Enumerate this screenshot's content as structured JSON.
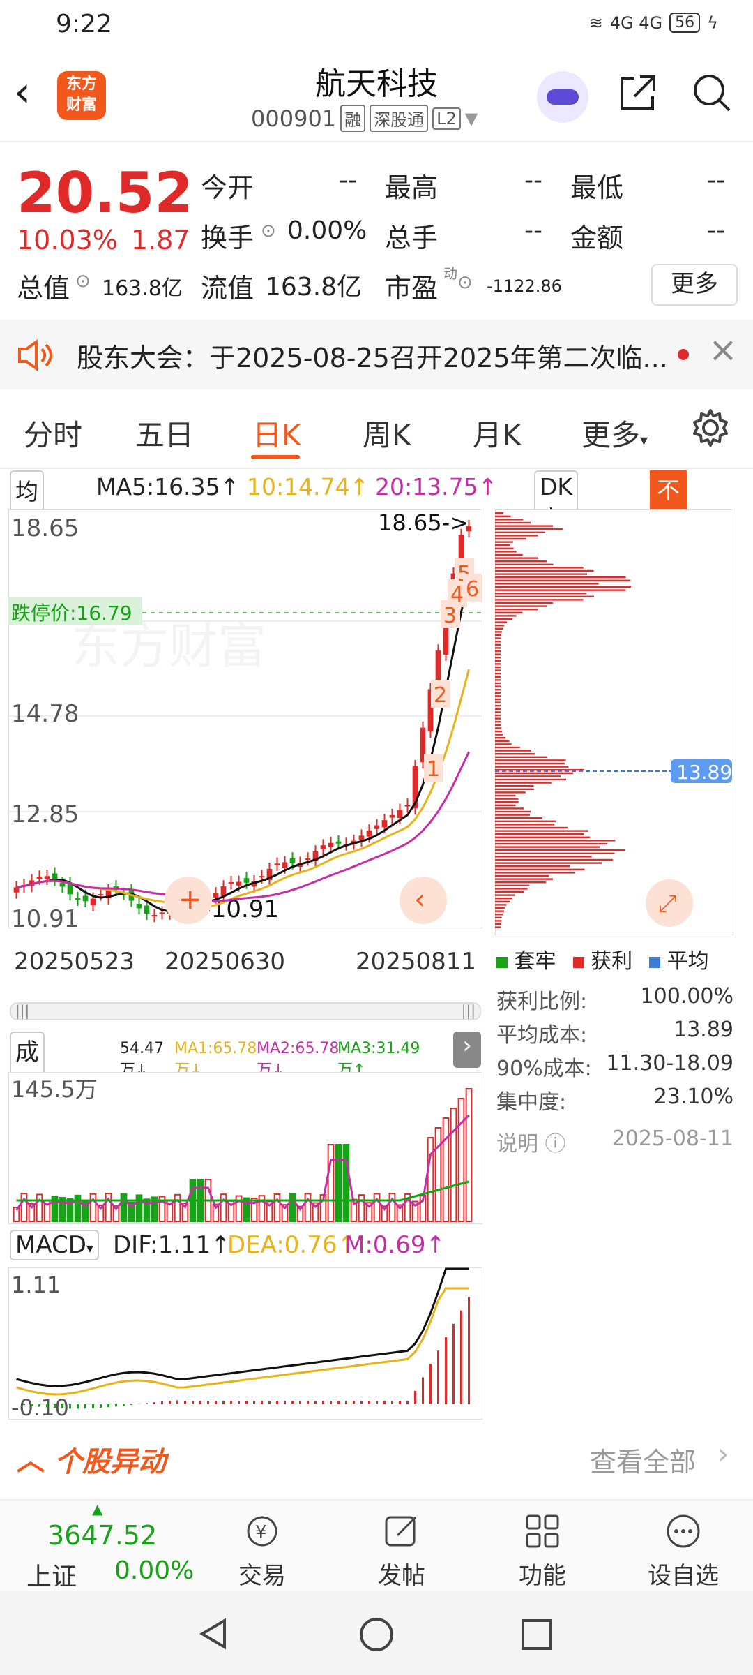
{
  "status_bar": {
    "time": "9:22",
    "signal": "4G 4G",
    "battery": "56"
  },
  "header": {
    "logo_line1": "东方",
    "logo_line2": "财富",
    "stock_name": "航天科技",
    "stock_code": "000901",
    "tags": [
      "融",
      "深股通",
      "L2"
    ]
  },
  "quote": {
    "price": "20.52",
    "change_pct": "10.03%",
    "change_amt": "1.87",
    "fields": {
      "open_label": "今开",
      "open_value": "--",
      "high_label": "最高",
      "high_value": "--",
      "low_label": "最低",
      "low_value": "--",
      "turnover_label": "换手",
      "turnover_value": "0.00%",
      "volume_label": "总手",
      "volume_value": "--",
      "amount_label": "金额",
      "amount_value": "--",
      "mcap_label": "总值",
      "mcap_value": "163.8亿",
      "float_label": "流值",
      "float_value": "163.8亿",
      "pe_label": "市盈",
      "pe_super": "动",
      "pe_value": "-1122.86"
    },
    "more_label": "更多"
  },
  "notice": {
    "text": "股东大会：于2025-08-25召开2025年第二次临..."
  },
  "tabs": [
    "分时",
    "五日",
    "日K",
    "周K",
    "月K",
    "更多"
  ],
  "active_tab": "日K",
  "ma_row": {
    "dropdown": "均线",
    "ma5": "MA5:16.35↑",
    "ma10": "10:14.74↑",
    "ma20": "20:13.75↑",
    "dk": "DK点",
    "fq": "不复权"
  },
  "kline": {
    "y_labels": [
      "18.65",
      "16.79",
      "14.78",
      "12.85",
      "10.91"
    ],
    "high_marker": "18.65->",
    "low_marker": "<-10.91",
    "limit_down_label": "跌停价:16.79",
    "dates": [
      "20250523",
      "20250630",
      "20250811"
    ],
    "watermark": "东方财富",
    "num_markers": [
      "1",
      "2",
      "3",
      "4",
      "5",
      "6"
    ]
  },
  "distribution": {
    "avg_cost_marker": "13.89",
    "legend": [
      "套牢",
      "获利",
      "平均"
    ],
    "rows": [
      {
        "label": "获利比例:",
        "value": "100.00%"
      },
      {
        "label": "平均成本:",
        "value": "13.89"
      },
      {
        "label": "90%成本:",
        "value": "11.30-18.09"
      },
      {
        "label": "集中度:",
        "value": "23.10%"
      },
      {
        "label": "说明",
        "value": "2025-08-11"
      }
    ]
  },
  "volume": {
    "dropdown": "成交量",
    "v": "54.47万↓",
    "ma1": "MA1:65.78万↓",
    "ma2": "MA2:65.78万↓",
    "ma3": "MA3:31.49万↑",
    "y_label": "145.5万"
  },
  "macd": {
    "dropdown": "MACD",
    "dif": "DIF:1.11↑",
    "dea": "DEA:0.76↑",
    "m": "M:0.69↑",
    "y_top": "1.11",
    "y_bottom": "-0.10"
  },
  "movement": {
    "title": "个股异动",
    "view_all": "查看全部"
  },
  "bottom_nav": {
    "index_value": "3647.52",
    "index_name": "上证",
    "index_pct": "0.00%",
    "items": [
      "交易",
      "发帖",
      "功能",
      "设自选"
    ]
  },
  "colors": {
    "up": "#e02a2a",
    "down": "#16a316",
    "accent": "#f2581b",
    "avg": "#3a7bd5"
  }
}
